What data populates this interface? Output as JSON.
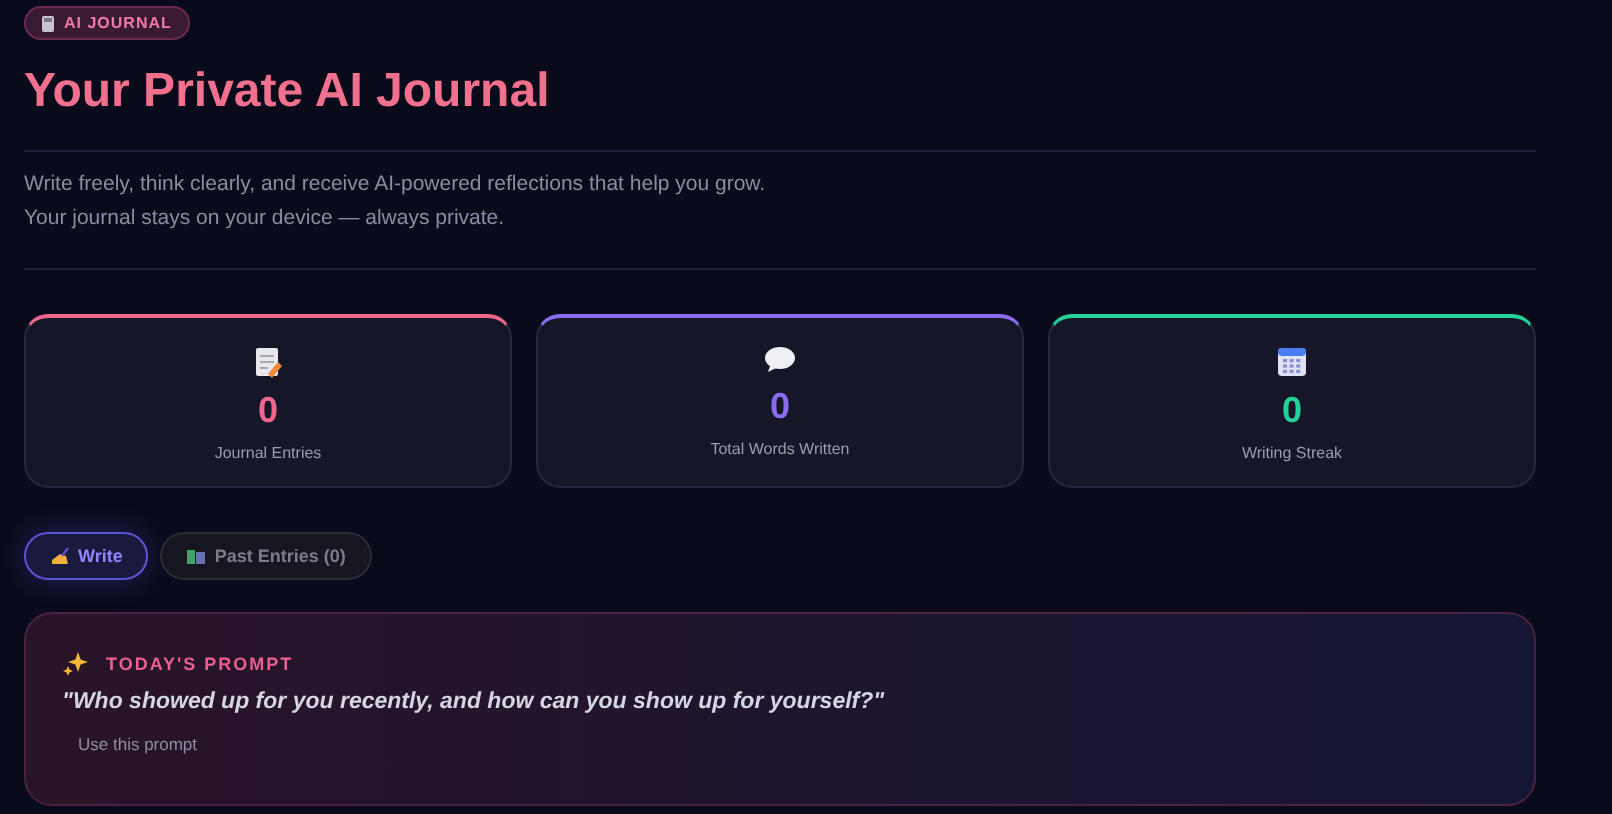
{
  "badge": "AI JOURNAL",
  "title": "Your Private AI Journal",
  "intro": [
    "Write freely, think clearly, and receive AI-powered reflections that help you grow.",
    "Your journal stays on your device — always private."
  ],
  "stats": [
    {
      "value": "0",
      "label": "Journal Entries",
      "color": "#f0668f"
    },
    {
      "value": "0",
      "label": "Total Words Written",
      "color": "#8b6cf0"
    },
    {
      "value": "0",
      "label": "Writing Streak",
      "color": "#25d39a"
    }
  ],
  "tabs": [
    {
      "label": "Write",
      "selected": true
    },
    {
      "label": "Past Entries (0)",
      "selected": false
    }
  ],
  "prompt": {
    "heading": "TODAY'S PROMPT",
    "text": "\"Who showed up for you recently, and how can you show up for yourself?\"",
    "action": "Use this prompt"
  }
}
